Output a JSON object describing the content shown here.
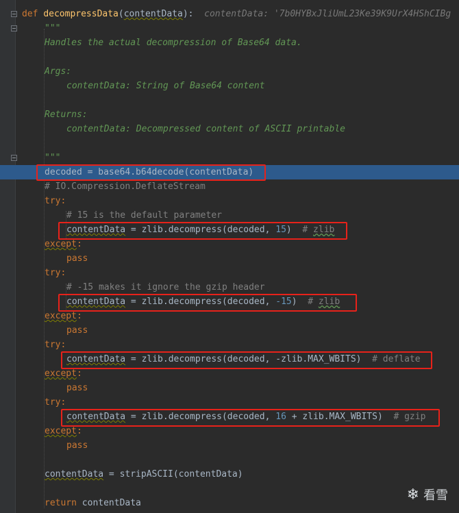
{
  "code": {
    "def_kw": "def",
    "func_name": "decompressData",
    "param_open": "(",
    "param_name": "contentData",
    "param_close": "):",
    "inline_hint": "contentData: '7b0HYBxJliUmL23Ke39K9UrX4HShCIBg",
    "doc_open": "\"\"\"",
    "doc_line1": "Handles the actual decompression of Base64 data.",
    "doc_args": "Args:",
    "doc_args_item": "contentData: String of Base64 content",
    "doc_returns": "Returns:",
    "doc_returns_item": "contentData: Decompressed content of ASCII printable",
    "doc_close": "\"\"\"",
    "decoded_line": "decoded = base64.b64decode(contentData)",
    "comment_stream": "# IO.Compression.DeflateStream",
    "try_kw": "try:",
    "except_kw": "except",
    "colon": ":",
    "pass_kw": "pass",
    "comment_default": "# 15 is the default parameter",
    "comment_neg15": "# -15 makes it ignore the gzip header",
    "var": "contentData",
    "call_prefix": " = zlib.decompress(decoded, ",
    "arg1": "15",
    "arg2": "-15",
    "arg3_pre": "-zlib.MAX_WBITS",
    "arg4_num": "16",
    "arg4_rest": " + zlib.MAX_WBITS",
    "close_paren": ")",
    "comment_hash": "#",
    "comment_zlib": "zlib",
    "comment_deflate": "# deflate",
    "comment_gzip": "# gzip",
    "strip_rest": " = stripASCII(contentData)",
    "return_kw": "return",
    "return_var": " contentData"
  },
  "watermark": {
    "text": "看雪",
    "icon": "snowflake-icon"
  },
  "colors": {
    "background": "#2b2b2b",
    "keyword": "#cc7832",
    "function": "#ffc66d",
    "docstring": "#629755",
    "comment": "#808080",
    "number": "#6897bb",
    "highlight": "#2d5a8c",
    "annotation_box": "#e8221a"
  }
}
